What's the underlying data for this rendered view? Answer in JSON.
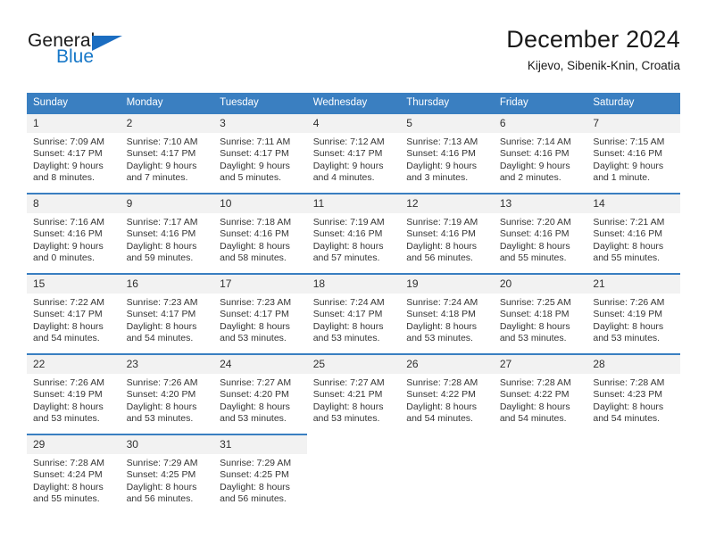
{
  "brand": {
    "name_part1": "General",
    "name_part2": "Blue",
    "logo_icon": "triangle-logo-icon"
  },
  "header": {
    "title": "December 2024",
    "subtitle": "Kijevo, Sibenik-Knin, Croatia"
  },
  "theme": {
    "header_blue": "#3a7fc1",
    "brand_blue": "#1878c8",
    "daynum_background": "#f2f2f2",
    "text": "#343434"
  },
  "weekdays": [
    "Sunday",
    "Monday",
    "Tuesday",
    "Wednesday",
    "Thursday",
    "Friday",
    "Saturday"
  ],
  "weeks": [
    [
      {
        "day": "1",
        "sunrise": "Sunrise: 7:09 AM",
        "sunset": "Sunset: 4:17 PM",
        "daylight_line1": "Daylight: 9 hours",
        "daylight_line2": "and 8 minutes."
      },
      {
        "day": "2",
        "sunrise": "Sunrise: 7:10 AM",
        "sunset": "Sunset: 4:17 PM",
        "daylight_line1": "Daylight: 9 hours",
        "daylight_line2": "and 7 minutes."
      },
      {
        "day": "3",
        "sunrise": "Sunrise: 7:11 AM",
        "sunset": "Sunset: 4:17 PM",
        "daylight_line1": "Daylight: 9 hours",
        "daylight_line2": "and 5 minutes."
      },
      {
        "day": "4",
        "sunrise": "Sunrise: 7:12 AM",
        "sunset": "Sunset: 4:17 PM",
        "daylight_line1": "Daylight: 9 hours",
        "daylight_line2": "and 4 minutes."
      },
      {
        "day": "5",
        "sunrise": "Sunrise: 7:13 AM",
        "sunset": "Sunset: 4:16 PM",
        "daylight_line1": "Daylight: 9 hours",
        "daylight_line2": "and 3 minutes."
      },
      {
        "day": "6",
        "sunrise": "Sunrise: 7:14 AM",
        "sunset": "Sunset: 4:16 PM",
        "daylight_line1": "Daylight: 9 hours",
        "daylight_line2": "and 2 minutes."
      },
      {
        "day": "7",
        "sunrise": "Sunrise: 7:15 AM",
        "sunset": "Sunset: 4:16 PM",
        "daylight_line1": "Daylight: 9 hours",
        "daylight_line2": "and 1 minute."
      }
    ],
    [
      {
        "day": "8",
        "sunrise": "Sunrise: 7:16 AM",
        "sunset": "Sunset: 4:16 PM",
        "daylight_line1": "Daylight: 9 hours",
        "daylight_line2": "and 0 minutes."
      },
      {
        "day": "9",
        "sunrise": "Sunrise: 7:17 AM",
        "sunset": "Sunset: 4:16 PM",
        "daylight_line1": "Daylight: 8 hours",
        "daylight_line2": "and 59 minutes."
      },
      {
        "day": "10",
        "sunrise": "Sunrise: 7:18 AM",
        "sunset": "Sunset: 4:16 PM",
        "daylight_line1": "Daylight: 8 hours",
        "daylight_line2": "and 58 minutes."
      },
      {
        "day": "11",
        "sunrise": "Sunrise: 7:19 AM",
        "sunset": "Sunset: 4:16 PM",
        "daylight_line1": "Daylight: 8 hours",
        "daylight_line2": "and 57 minutes."
      },
      {
        "day": "12",
        "sunrise": "Sunrise: 7:19 AM",
        "sunset": "Sunset: 4:16 PM",
        "daylight_line1": "Daylight: 8 hours",
        "daylight_line2": "and 56 minutes."
      },
      {
        "day": "13",
        "sunrise": "Sunrise: 7:20 AM",
        "sunset": "Sunset: 4:16 PM",
        "daylight_line1": "Daylight: 8 hours",
        "daylight_line2": "and 55 minutes."
      },
      {
        "day": "14",
        "sunrise": "Sunrise: 7:21 AM",
        "sunset": "Sunset: 4:16 PM",
        "daylight_line1": "Daylight: 8 hours",
        "daylight_line2": "and 55 minutes."
      }
    ],
    [
      {
        "day": "15",
        "sunrise": "Sunrise: 7:22 AM",
        "sunset": "Sunset: 4:17 PM",
        "daylight_line1": "Daylight: 8 hours",
        "daylight_line2": "and 54 minutes."
      },
      {
        "day": "16",
        "sunrise": "Sunrise: 7:23 AM",
        "sunset": "Sunset: 4:17 PM",
        "daylight_line1": "Daylight: 8 hours",
        "daylight_line2": "and 54 minutes."
      },
      {
        "day": "17",
        "sunrise": "Sunrise: 7:23 AM",
        "sunset": "Sunset: 4:17 PM",
        "daylight_line1": "Daylight: 8 hours",
        "daylight_line2": "and 53 minutes."
      },
      {
        "day": "18",
        "sunrise": "Sunrise: 7:24 AM",
        "sunset": "Sunset: 4:17 PM",
        "daylight_line1": "Daylight: 8 hours",
        "daylight_line2": "and 53 minutes."
      },
      {
        "day": "19",
        "sunrise": "Sunrise: 7:24 AM",
        "sunset": "Sunset: 4:18 PM",
        "daylight_line1": "Daylight: 8 hours",
        "daylight_line2": "and 53 minutes."
      },
      {
        "day": "20",
        "sunrise": "Sunrise: 7:25 AM",
        "sunset": "Sunset: 4:18 PM",
        "daylight_line1": "Daylight: 8 hours",
        "daylight_line2": "and 53 minutes."
      },
      {
        "day": "21",
        "sunrise": "Sunrise: 7:26 AM",
        "sunset": "Sunset: 4:19 PM",
        "daylight_line1": "Daylight: 8 hours",
        "daylight_line2": "and 53 minutes."
      }
    ],
    [
      {
        "day": "22",
        "sunrise": "Sunrise: 7:26 AM",
        "sunset": "Sunset: 4:19 PM",
        "daylight_line1": "Daylight: 8 hours",
        "daylight_line2": "and 53 minutes."
      },
      {
        "day": "23",
        "sunrise": "Sunrise: 7:26 AM",
        "sunset": "Sunset: 4:20 PM",
        "daylight_line1": "Daylight: 8 hours",
        "daylight_line2": "and 53 minutes."
      },
      {
        "day": "24",
        "sunrise": "Sunrise: 7:27 AM",
        "sunset": "Sunset: 4:20 PM",
        "daylight_line1": "Daylight: 8 hours",
        "daylight_line2": "and 53 minutes."
      },
      {
        "day": "25",
        "sunrise": "Sunrise: 7:27 AM",
        "sunset": "Sunset: 4:21 PM",
        "daylight_line1": "Daylight: 8 hours",
        "daylight_line2": "and 53 minutes."
      },
      {
        "day": "26",
        "sunrise": "Sunrise: 7:28 AM",
        "sunset": "Sunset: 4:22 PM",
        "daylight_line1": "Daylight: 8 hours",
        "daylight_line2": "and 54 minutes."
      },
      {
        "day": "27",
        "sunrise": "Sunrise: 7:28 AM",
        "sunset": "Sunset: 4:22 PM",
        "daylight_line1": "Daylight: 8 hours",
        "daylight_line2": "and 54 minutes."
      },
      {
        "day": "28",
        "sunrise": "Sunrise: 7:28 AM",
        "sunset": "Sunset: 4:23 PM",
        "daylight_line1": "Daylight: 8 hours",
        "daylight_line2": "and 54 minutes."
      }
    ],
    [
      {
        "day": "29",
        "sunrise": "Sunrise: 7:28 AM",
        "sunset": "Sunset: 4:24 PM",
        "daylight_line1": "Daylight: 8 hours",
        "daylight_line2": "and 55 minutes."
      },
      {
        "day": "30",
        "sunrise": "Sunrise: 7:29 AM",
        "sunset": "Sunset: 4:25 PM",
        "daylight_line1": "Daylight: 8 hours",
        "daylight_line2": "and 56 minutes."
      },
      {
        "day": "31",
        "sunrise": "Sunrise: 7:29 AM",
        "sunset": "Sunset: 4:25 PM",
        "daylight_line1": "Daylight: 8 hours",
        "daylight_line2": "and 56 minutes."
      },
      {
        "day": "",
        "sunrise": "",
        "sunset": "",
        "daylight_line1": "",
        "daylight_line2": ""
      },
      {
        "day": "",
        "sunrise": "",
        "sunset": "",
        "daylight_line1": "",
        "daylight_line2": ""
      },
      {
        "day": "",
        "sunrise": "",
        "sunset": "",
        "daylight_line1": "",
        "daylight_line2": ""
      },
      {
        "day": "",
        "sunrise": "",
        "sunset": "",
        "daylight_line1": "",
        "daylight_line2": ""
      }
    ]
  ]
}
